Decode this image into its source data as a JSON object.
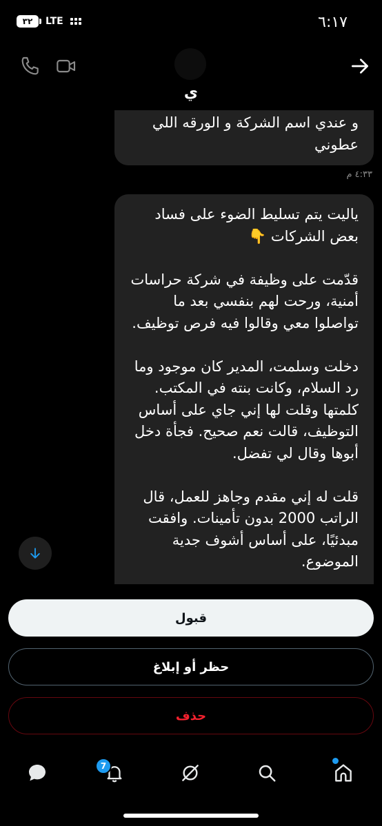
{
  "status_bar": {
    "time": "٦:١٧",
    "battery": "٣٢",
    "network": "LTE"
  },
  "header": {
    "contact_name": "ي"
  },
  "messages": [
    {
      "text": "و عندي اسم الشركة و الورقه اللي عطوني",
      "timestamp": "٤:٣٣ م"
    },
    {
      "text": "ياليت يتم تسليط الضوء على فساد بعض الشركات 👇\n\nقدّمت على وظيفة في شركة حراسات أمنية، ورحت لهم بنفسي بعد ما تواصلوا معي وقالوا فيه فرص توظيف.\n\nدخلت وسلمت، المدير كان موجود وما رد السلام، وكانت بنته في المكتب. كلمتها وقلت لها إني جاي على أساس التوظيف، قالت نعم صحيح. فجأة دخل أبوها وقال لي تفضل.\n\nقلت له إني مقدم وجاهز للعمل، قال الراتب 2000 بدون تأمينات. وافقت مبدئيًا، على أساس أشوف جدية الموضوع.\n\nلكن بعدها مباشرة سألني: من أي محافظة؟"
    }
  ],
  "actions": {
    "accept": "قبول",
    "block_report": "حظر أو إبلاغ",
    "delete": "حذف"
  },
  "tabbar": {
    "notifications_badge": "7"
  },
  "colors": {
    "accent": "#1d9bf0",
    "danger": "#f4212e",
    "bubble": "#222222"
  }
}
